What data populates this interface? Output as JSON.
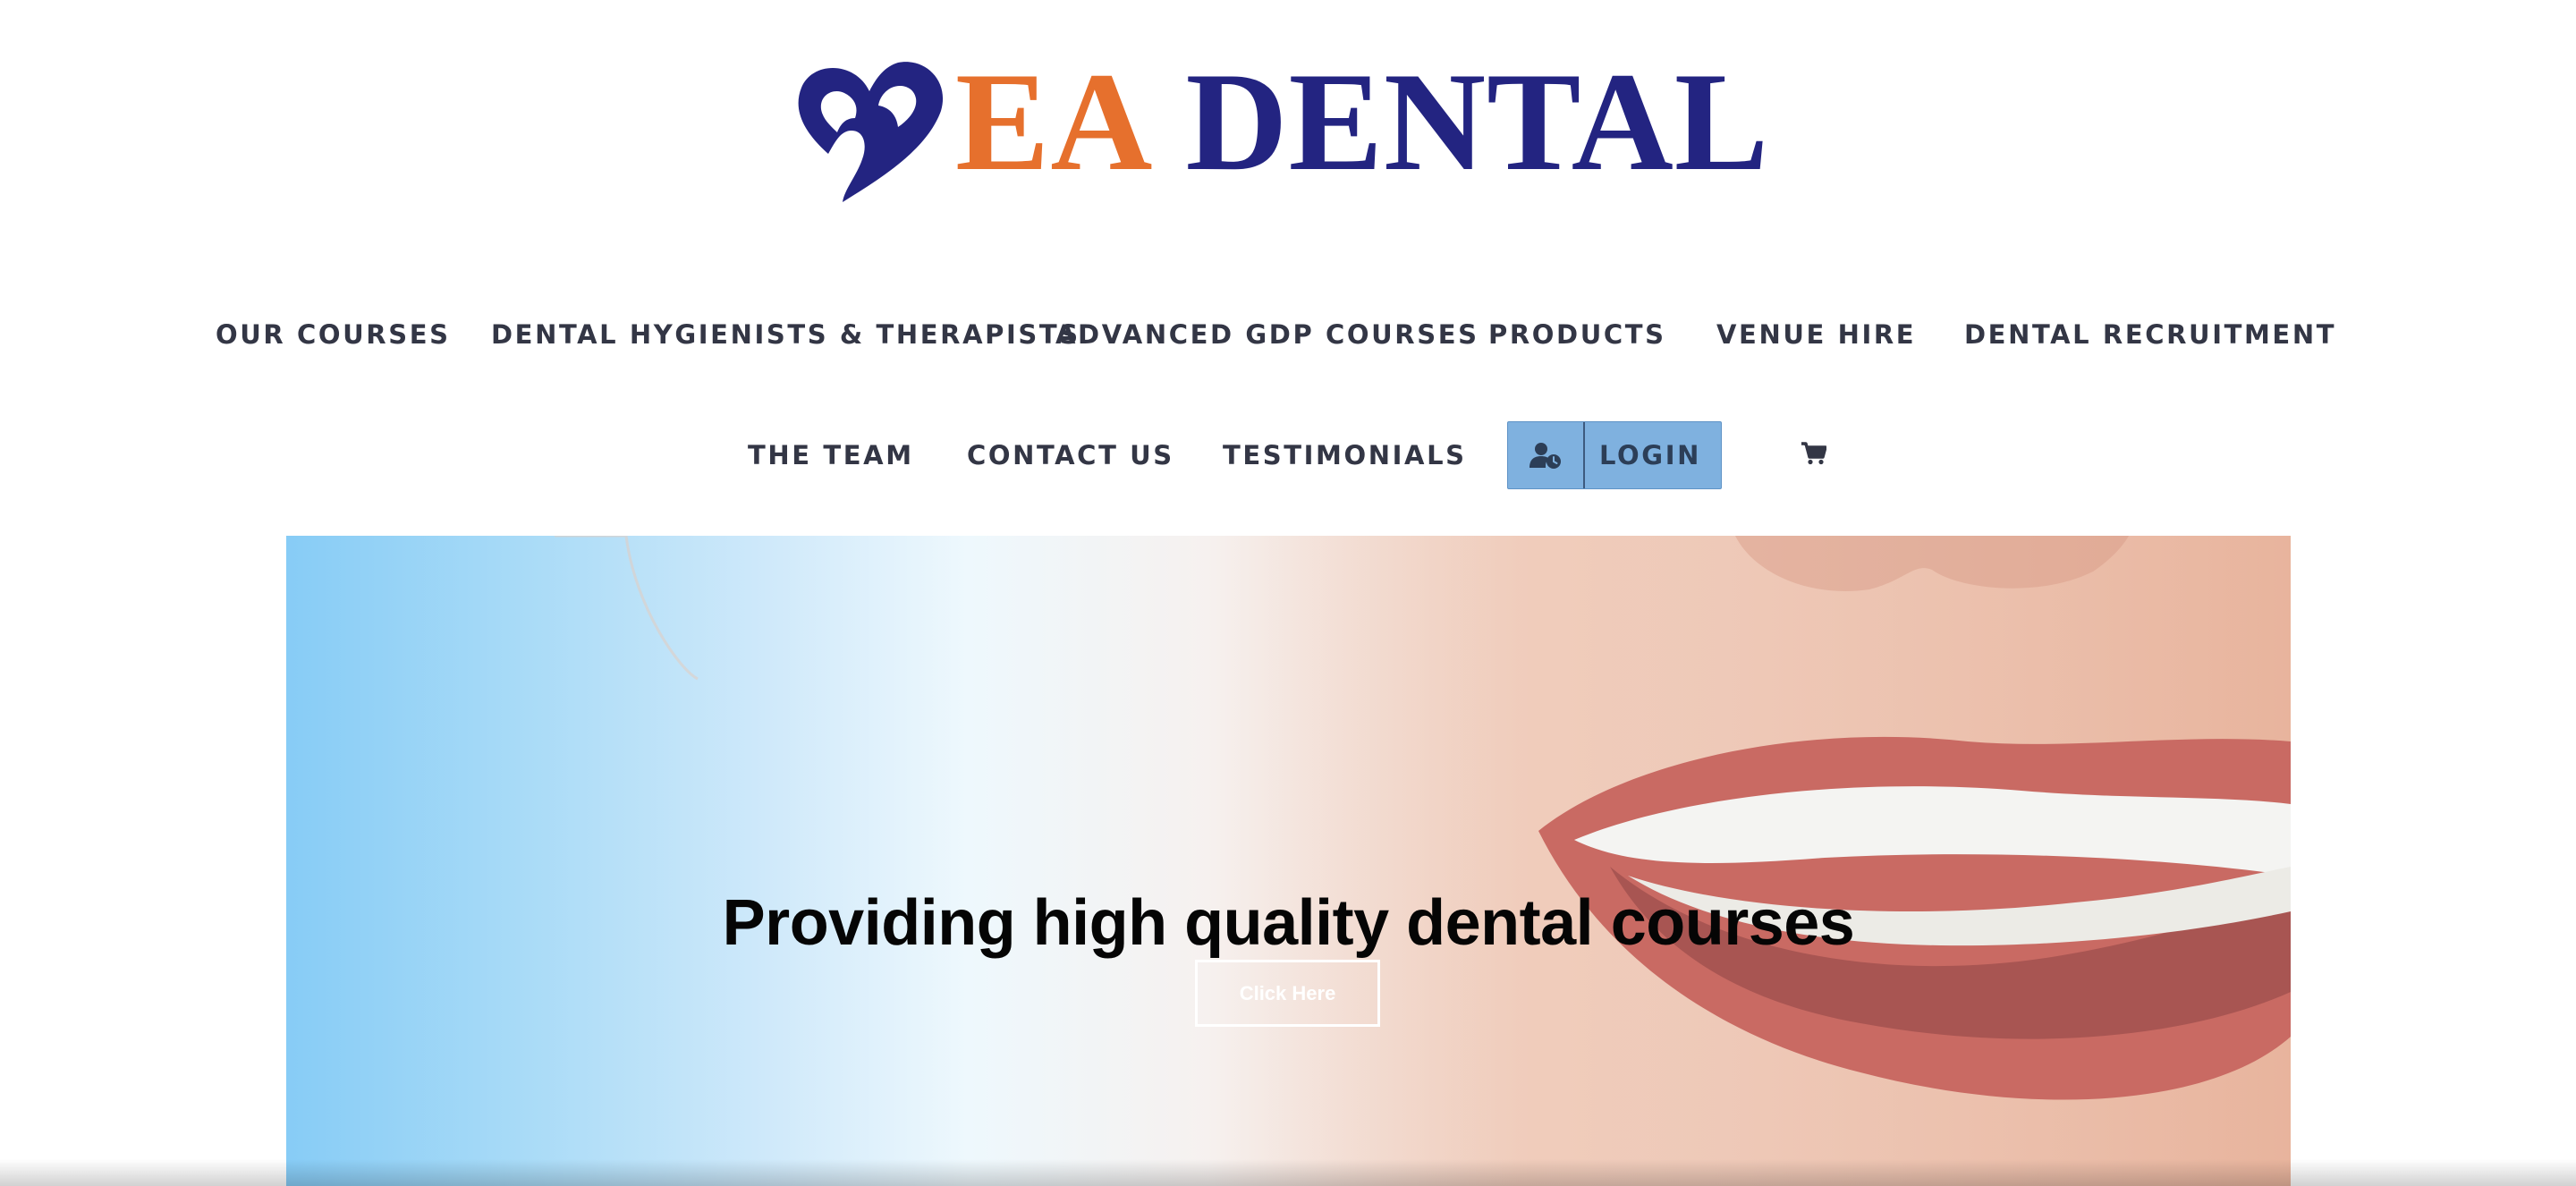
{
  "brand": {
    "name_part1": "EA",
    "name_part2": "DENTAL",
    "colors": {
      "accent_orange": "#e6702d",
      "navy": "#232481"
    },
    "logo_icon": "tooth-heart-icon"
  },
  "nav": {
    "row1": [
      {
        "label": "OUR COURSES"
      },
      {
        "label": "DENTAL HYGIENISTS & THERAPISTS"
      },
      {
        "label": "ADVANCED GDP COURSES"
      },
      {
        "label": "PRODUCTS"
      },
      {
        "label": "VENUE HIRE"
      },
      {
        "label": "DENTAL RECRUITMENT"
      }
    ],
    "row2": [
      {
        "label": "THE TEAM"
      },
      {
        "label": "CONTACT US"
      },
      {
        "label": "TESTIMONIALS"
      }
    ],
    "login": {
      "label": "LOGIN",
      "icon": "user-clock-icon",
      "color": "#7fb1df"
    },
    "cart": {
      "icon": "shopping-cart-icon"
    }
  },
  "hero": {
    "title": "Providing high quality dental courses",
    "button_label": "Click Here"
  }
}
